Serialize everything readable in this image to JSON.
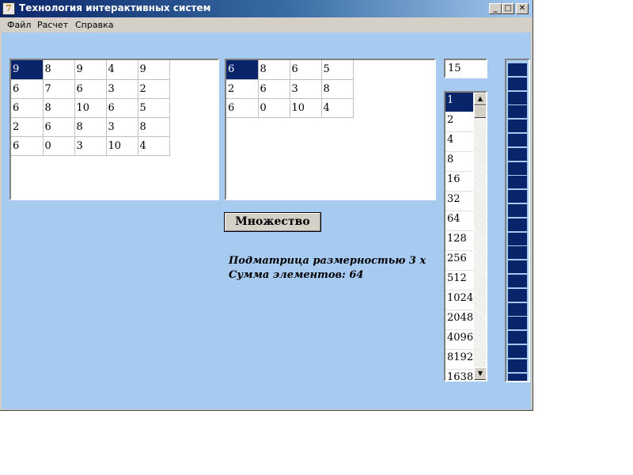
{
  "window": {
    "title": "Технология интерактивных систем",
    "icon_letter": "7",
    "controls": {
      "minimize": "_",
      "maximize": "□",
      "close": "✕"
    }
  },
  "menu": [
    "Файл",
    "Расчет",
    "Справка"
  ],
  "grid1": {
    "rows": [
      [
        "9",
        "8",
        "9",
        "4",
        "9"
      ],
      [
        "6",
        "7",
        "6",
        "3",
        "2"
      ],
      [
        "6",
        "8",
        "10",
        "6",
        "5"
      ],
      [
        "2",
        "6",
        "8",
        "3",
        "8"
      ],
      [
        "6",
        "0",
        "3",
        "10",
        "4"
      ]
    ],
    "selected_cell": "r0c0"
  },
  "grid2": {
    "rows": [
      [
        "6",
        "8",
        "6",
        "5"
      ],
      [
        "2",
        "6",
        "3",
        "8"
      ],
      [
        "6",
        "0",
        "10",
        "4"
      ]
    ],
    "selected_cell": "r0c0"
  },
  "action_button": "Множество",
  "result": {
    "line1": "Подматрица размерностью 3 х",
    "line2": "Сумма элементов: 64"
  },
  "edit_value": "15",
  "list": {
    "items": [
      "1",
      "2",
      "4",
      "8",
      "16",
      "32",
      "64",
      "128",
      "256",
      "512",
      "1024",
      "2048",
      "4096",
      "8192",
      "1638"
    ],
    "selected_index": 0,
    "scroll_up": "▲",
    "scroll_down": "▼"
  },
  "colors": {
    "client_bg": "#a6caf0",
    "selection": "#0a246a",
    "titlebar_start": "#0a246a"
  }
}
